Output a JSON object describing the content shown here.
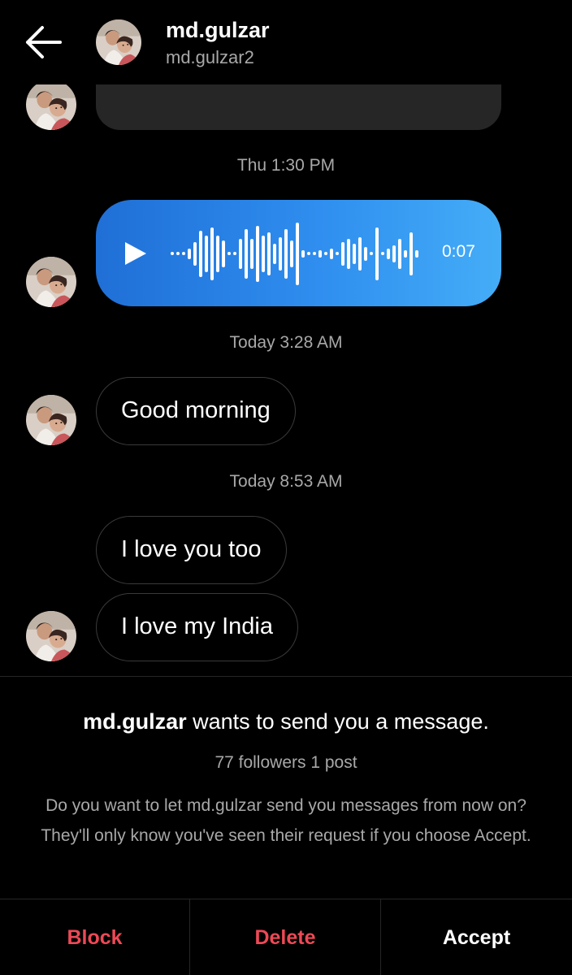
{
  "header": {
    "name": "md.gulzar",
    "username": "md.gulzar2"
  },
  "thread": {
    "timestamp_1": "Thu 1:30 PM",
    "voice_duration": "0:07",
    "timestamp_2": "Today 3:28 AM",
    "message_1": "Good morning",
    "timestamp_3": "Today 8:53 AM",
    "message_2": "I love you too",
    "message_3": "I love my India"
  },
  "request": {
    "name": "md.gulzar",
    "title_suffix": " wants to send you a message.",
    "stats": "77 followers 1 post",
    "body": "Do you want to let md.gulzar send you messages from now on? They'll only know you've seen their request if you choose Accept."
  },
  "actions": {
    "block": "Block",
    "delete": "Delete",
    "accept": "Accept"
  },
  "icons": {
    "back": "arrow-left-icon",
    "play": "play-icon",
    "waveform": "waveform-icon"
  },
  "colors": {
    "voice_bubble_start": "#1f6fd6",
    "voice_bubble_end": "#44adf7",
    "destructive": "#ed4956",
    "secondary_text": "#a8a8a8"
  }
}
